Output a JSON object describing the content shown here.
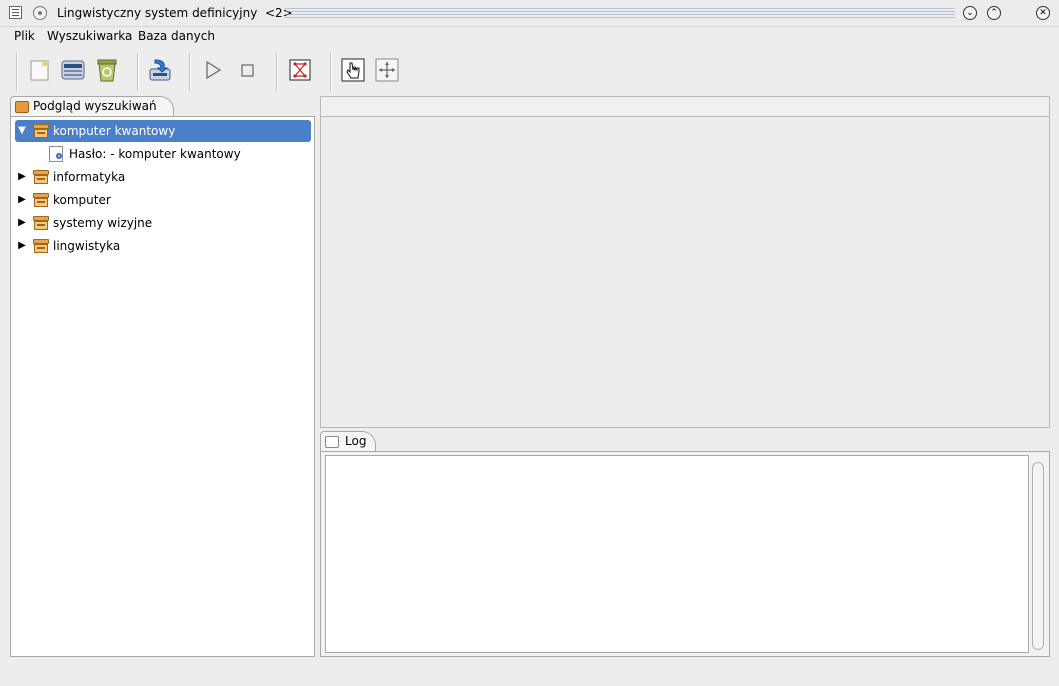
{
  "window": {
    "title": "Lingwistyczny system definicyjny",
    "title_suffix": "<2>",
    "minimize_glyph": "⌄",
    "maximize_glyph": "⌃",
    "close_glyph": "✕"
  },
  "menu": {
    "items": [
      {
        "label": "Plik"
      },
      {
        "label": "Wyszukiwarka"
      },
      {
        "label": "Baza danych"
      }
    ]
  },
  "toolbar": {
    "buttons": [
      {
        "icon": "new-document-icon"
      },
      {
        "icon": "database-icon"
      },
      {
        "icon": "recycle-bin-icon"
      },
      {
        "icon": "import-icon"
      },
      {
        "icon": "play-icon"
      },
      {
        "icon": "stop-icon"
      },
      {
        "icon": "node-graph-icon"
      },
      {
        "icon": "pointer-hand-icon"
      },
      {
        "icon": "move-icon"
      }
    ]
  },
  "search_view": {
    "tab_label": "Podgląd wyszukiwań",
    "tree": [
      {
        "label": "komputer kwantowy",
        "expanded": true,
        "selected": true,
        "children": [
          {
            "label": "Hasło: - komputer kwantowy"
          }
        ]
      },
      {
        "label": "informatyka",
        "expanded": false
      },
      {
        "label": "komputer",
        "expanded": false
      },
      {
        "label": "systemy wizyjne",
        "expanded": false
      },
      {
        "label": "lingwistyka",
        "expanded": false
      }
    ]
  },
  "log": {
    "tab_label": "Log",
    "content": ""
  },
  "colors": {
    "selection": "#4a7fc9",
    "background": "#ededed",
    "box_icon": "#e3a64a"
  }
}
